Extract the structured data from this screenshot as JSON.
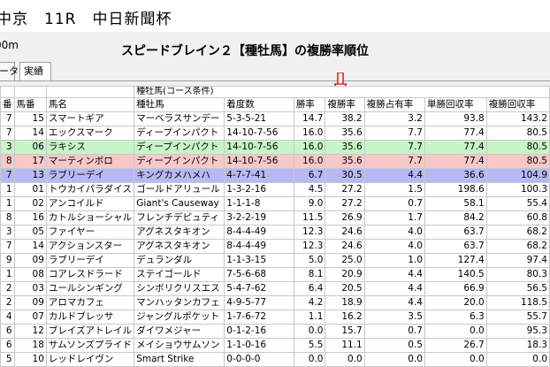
{
  "race": {
    "title": "中京　11R　中日新聞杯"
  },
  "distance_text": "00m",
  "ranking_title": "スピードブレイン２【種牡馬】の複勝率順位",
  "tabs": [
    {
      "label": "ータ"
    },
    {
      "label": "実績"
    }
  ],
  "table": {
    "group_header": "種牡馬(コース条件)",
    "columns": [
      "番",
      "馬番",
      "馬名",
      "種牡馬",
      "着度数",
      "勝率",
      "複勝率",
      "複勝占有率",
      "単勝回収率",
      "複勝回収率"
    ],
    "rows": [
      {
        "waku": "7",
        "umaban": "15",
        "name": "スマートギア",
        "sire": "マーベラスサンデー",
        "record": "5-3-5-21",
        "win": "14.7",
        "place": "38.2",
        "share": "3.2",
        "tan": "93.8",
        "fuku": "143.2",
        "hl": ""
      },
      {
        "waku": "7",
        "umaban": "14",
        "name": "エックスマーク",
        "sire": "ディープインパクト",
        "record": "14-10-7-56",
        "win": "16.0",
        "place": "35.6",
        "share": "7.7",
        "tan": "77.4",
        "fuku": "80.5",
        "hl": ""
      },
      {
        "waku": "3",
        "umaban": "06",
        "name": "ラキシス",
        "sire": "ディープインパクト",
        "record": "14-10-7-56",
        "win": "16.0",
        "place": "35.6",
        "share": "7.7",
        "tan": "77.4",
        "fuku": "80.5",
        "hl": "green"
      },
      {
        "waku": "8",
        "umaban": "17",
        "name": "マーティンボロ",
        "sire": "ディープインパクト",
        "record": "14-10-7-56",
        "win": "16.0",
        "place": "35.6",
        "share": "7.7",
        "tan": "77.4",
        "fuku": "80.5",
        "hl": "pink"
      },
      {
        "waku": "7",
        "umaban": "13",
        "name": "ラブリーデイ",
        "sire": "キングカメハメハ",
        "record": "4-7-7-41",
        "win": "6.7",
        "place": "30.5",
        "share": "4.4",
        "tan": "36.6",
        "fuku": "104.9",
        "hl": "blue"
      },
      {
        "waku": "1",
        "umaban": "01",
        "name": "トウカイパラダイス",
        "sire": "ゴールドアリュール",
        "record": "1-3-2-16",
        "win": "4.5",
        "place": "27.2",
        "share": "1.5",
        "tan": "198.6",
        "fuku": "100.3",
        "hl": ""
      },
      {
        "waku": "1",
        "umaban": "02",
        "name": "アンコイルド",
        "sire": "Giant's Causeway",
        "record": "1-1-1-8",
        "win": "9.0",
        "place": "27.2",
        "share": "0.7",
        "tan": "58.1",
        "fuku": "55.4",
        "hl": ""
      },
      {
        "waku": "8",
        "umaban": "16",
        "name": "カトルショーシャル",
        "sire": "フレンチデピュティ",
        "record": "3-2-2-19",
        "win": "11.5",
        "place": "26.9",
        "share": "1.7",
        "tan": "84.2",
        "fuku": "60.8",
        "hl": ""
      },
      {
        "waku": "3",
        "umaban": "05",
        "name": "ファイヤー",
        "sire": "アグネスタキオン",
        "record": "8-4-4-49",
        "win": "12.3",
        "place": "24.6",
        "share": "4.0",
        "tan": "63.7",
        "fuku": "68.2",
        "hl": ""
      },
      {
        "waku": "7",
        "umaban": "14",
        "name": "アクションスター",
        "sire": "アグネスタキオン",
        "record": "8-4-4-49",
        "win": "12.3",
        "place": "24.6",
        "share": "4.0",
        "tan": "63.7",
        "fuku": "68.2",
        "hl": ""
      },
      {
        "waku": "9",
        "umaban": "09",
        "name": "ラブリーデイ",
        "sire": "デュランダル",
        "record": "1-1-3-15",
        "win": "5.0",
        "place": "25.0",
        "share": "1.0",
        "tan": "127.4",
        "fuku": "97.4",
        "hl": ""
      },
      {
        "waku": "1",
        "umaban": "08",
        "name": "コアレスドラード",
        "sire": "ステイゴールド",
        "record": "7-5-6-68",
        "win": "8.1",
        "place": "20.9",
        "share": "4.4",
        "tan": "140.5",
        "fuku": "80.3",
        "hl": ""
      },
      {
        "waku": "2",
        "umaban": "03",
        "name": "ユールシンギング",
        "sire": "シンボリクリスエス",
        "record": "5-4-7-62",
        "win": "6.4",
        "place": "20.5",
        "share": "4.4",
        "tan": "66.9",
        "fuku": "56.5",
        "hl": ""
      },
      {
        "waku": "2",
        "umaban": "09",
        "name": "アロマカフェ",
        "sire": "マンハッタンカフェ",
        "record": "4-9-5-77",
        "win": "4.2",
        "place": "18.9",
        "share": "4.4",
        "tan": "20.0",
        "fuku": "118.5",
        "hl": ""
      },
      {
        "waku": "4",
        "umaban": "07",
        "name": "カルドブレッサ",
        "sire": "ジャングルポケット",
        "record": "1-7-6-72",
        "win": "1.1",
        "place": "16.2",
        "share": "3.5",
        "tan": "6.3",
        "fuku": "55.7",
        "hl": ""
      },
      {
        "waku": "6",
        "umaban": "12",
        "name": "ブレイズアトレイル",
        "sire": "ダイワメジャー",
        "record": "0-1-2-16",
        "win": "0.0",
        "place": "15.7",
        "share": "0.7",
        "tan": "0.0",
        "fuku": "95.3",
        "hl": ""
      },
      {
        "waku": "6",
        "umaban": "18",
        "name": "サムソンズプライド",
        "sire": "メイショウサムソン",
        "record": "1-1-0-16",
        "win": "5.5",
        "place": "11.1",
        "share": "0.5",
        "tan": "26.7",
        "fuku": "18.3",
        "hl": ""
      },
      {
        "waku": "5",
        "umaban": "10",
        "name": "レッドレイヴン",
        "sire": "Smart Strike",
        "record": "0-0-0-0",
        "win": "0.0",
        "place": "0.0",
        "share": "0.0",
        "tan": "0.0",
        "fuku": "0.0",
        "hl": ""
      }
    ]
  },
  "colors": {
    "arrow": "#e02020",
    "green_row": "#c8f4c8",
    "pink_row": "#f8c8c8",
    "blue_row": "#b8b8f4"
  },
  "icons": {
    "sort_arrow": "down-arrow-icon"
  }
}
